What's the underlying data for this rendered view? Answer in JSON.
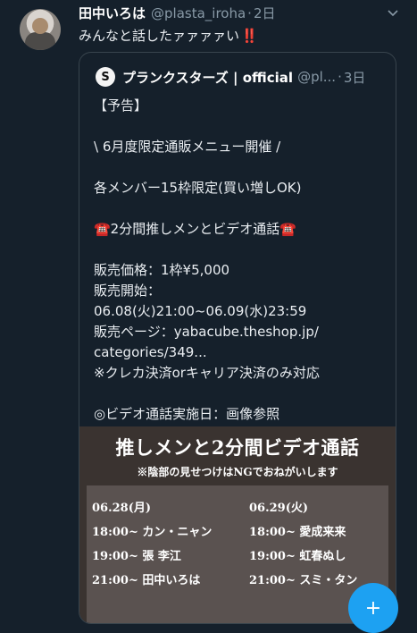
{
  "tweet": {
    "name": "田中いろは",
    "handle": "@plasta_iroha",
    "time": "2日",
    "text": "みんなと話したァァァァい",
    "emoji": "‼️"
  },
  "quote": {
    "avatar_glyph": "S",
    "name": "プランクスターズ | official",
    "handle": "@pl...",
    "time": "3日",
    "lines": [
      "【予告】",
      "",
      "\\ 6月度限定通販メニュー開催 /",
      "",
      "各メンバー15枠限定(買い増しOK)",
      "",
      "☎️2分間推しメンとビデオ通話☎️",
      "",
      "販売価格：1枠¥5,000",
      "販売開始：",
      "06.08(火)21:00~06.09(水)23:59",
      "販売ページ：yabacube.theshop.jp/",
      "categories/349...",
      "※クレカ決済orキャリア決済のみ対応",
      "",
      "◎ビデオ通話実施日：画像参照"
    ]
  },
  "media": {
    "title": "推しメンと2分間ビデオ通話",
    "subtitle": "※陰部の見せつけはNGでおねがいします",
    "left": {
      "date": "06.28(月)",
      "slots": [
        "18:00~ カン・ニャン",
        "19:00~ 張 李江",
        "21:00~ 田中いろは"
      ]
    },
    "right": {
      "date": "06.29(火)",
      "slots": [
        "18:00~ 愛成来来",
        "19:00~ 虹春ぬし",
        "21:00~ スミ・タン"
      ]
    }
  },
  "fab_icon": "compose-icon"
}
